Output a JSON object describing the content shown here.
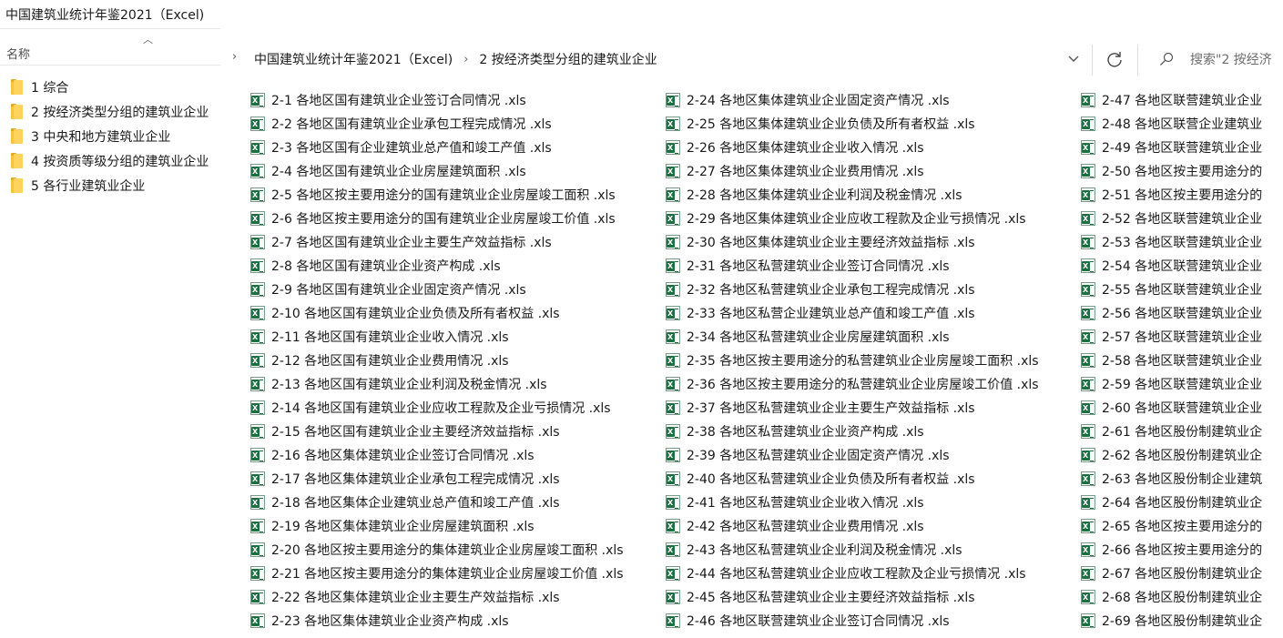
{
  "window": {
    "title": "中国建筑业统计年鉴2021（Excel)"
  },
  "left_pane": {
    "column_header": "名称",
    "folders": [
      {
        "label": "1 综合"
      },
      {
        "label": "2 按经济类型分组的建筑业企业"
      },
      {
        "label": "3 中央和地方建筑业企业"
      },
      {
        "label": "4 按资质等级分组的建筑业企业"
      },
      {
        "label": "5 各行业建筑业企业"
      }
    ]
  },
  "address_bar": {
    "crumbs": [
      "中国建筑业统计年鉴2021（Excel)",
      "2 按经济类型分组的建筑业企业"
    ],
    "search_placeholder": "搜索\"2 按经济"
  },
  "files": {
    "col1": [
      "2-1 各地区国有建筑业企业签订合同情况 .xls",
      "2-2 各地区国有建筑业企业承包工程完成情况 .xls",
      "2-3 各地区国有企业建筑业总产值和竣工产值 .xls",
      "2-4 各地区国有建筑业企业房屋建筑面积 .xls",
      "2-5 各地区按主要用途分的国有建筑业企业房屋竣工面积 .xls",
      "2-6 各地区按主要用途分的国有建筑业企业房屋竣工价值 .xls",
      "2-7 各地区国有建筑业企业主要生产效益指标 .xls",
      "2-8 各地区国有建筑业企业资产构成 .xls",
      "2-9 各地区国有建筑业企业固定资产情况 .xls",
      "2-10 各地区国有建筑业企业负债及所有者权益 .xls",
      "2-11 各地区国有建筑业企业收入情况 .xls",
      "2-12 各地区国有建筑业企业费用情况 .xls",
      "2-13 各地区国有建筑业企业利润及税金情况 .xls",
      "2-14 各地区国有建筑业企业应收工程款及企业亏损情况 .xls",
      "2-15 各地区国有建筑业企业主要经济效益指标 .xls",
      "2-16 各地区集体建筑业企业签订合同情况 .xls",
      "2-17 各地区集体建筑业企业承包工程完成情况 .xls",
      "2-18 各地区集体企业建筑业总产值和竣工产值 .xls",
      "2-19 各地区集体建筑业企业房屋建筑面积 .xls",
      "2-20 各地区按主要用途分的集体建筑业企业房屋竣工面积 .xls",
      "2-21 各地区按主要用途分的集体建筑业企业房屋竣工价值 .xls",
      "2-22 各地区集体建筑业企业主要生产效益指标 .xls",
      "2-23 各地区集体建筑业企业资产构成 .xls"
    ],
    "col2": [
      "2-24 各地区集体建筑业企业固定资产情况 .xls",
      "2-25 各地区集体建筑业企业负债及所有者权益 .xls",
      "2-26 各地区集体建筑业企业收入情况 .xls",
      "2-27 各地区集体建筑业企业费用情况 .xls",
      "2-28 各地区集体建筑业企业利润及税金情况 .xls",
      "2-29 各地区集体建筑业企业应收工程款及企业亏损情况 .xls",
      "2-30 各地区集体建筑业企业主要经济效益指标 .xls",
      "2-31 各地区私营建筑业企业签订合同情况 .xls",
      "2-32 各地区私营建筑业企业承包工程完成情况 .xls",
      "2-33 各地区私营企业建筑业总产值和竣工产值 .xls",
      "2-34 各地区私营建筑业企业房屋建筑面积 .xls",
      "2-35 各地区按主要用途分的私营建筑业企业房屋竣工面积 .xls",
      "2-36 各地区按主要用途分的私营建筑业企业房屋竣工价值 .xls",
      "2-37 各地区私营建筑业企业主要生产效益指标 .xls",
      "2-38 各地区私营建筑业企业资产构成 .xls",
      "2-39 各地区私营建筑业企业固定资产情况 .xls",
      "2-40 各地区私营建筑业企业负债及所有者权益 .xls",
      "2-41 各地区私营建筑业企业收入情况 .xls",
      "2-42 各地区私营建筑业企业费用情况 .xls",
      "2-43 各地区私营建筑业企业利润及税金情况 .xls",
      "2-44 各地区私营建筑业企业应收工程款及企业亏损情况 .xls",
      "2-45 各地区私营建筑业企业主要经济效益指标 .xls",
      "2-46 各地区联营建筑业企业签订合同情况 .xls"
    ],
    "col3": [
      "2-47 各地区联营建筑业企业",
      "2-48 各地区联营企业建筑业",
      "2-49 各地区联营建筑业企业",
      "2-50 各地区按主要用途分的",
      "2-51 各地区按主要用途分的",
      "2-52 各地区联营建筑业企业",
      "2-53 各地区联营建筑业企业",
      "2-54 各地区联营建筑业企业",
      "2-55 各地区联营建筑业企业",
      "2-56 各地区联营建筑业企业",
      "2-57 各地区联营建筑业企业",
      "2-58 各地区联营建筑业企业",
      "2-59 各地区联营建筑业企业",
      "2-60 各地区联营建筑业企业",
      "2-61 各地区股份制建筑业企",
      "2-62 各地区股份制建筑业企",
      "2-63 各地区股份制企业建筑",
      "2-64 各地区股份制建筑业企",
      "2-65 各地区按主要用途分的",
      "2-66 各地区按主要用途分的",
      "2-67 各地区股份制建筑业企",
      "2-68 各地区股份制建筑业企",
      "2-69 各地区股份制建筑业企"
    ]
  },
  "colors": {
    "excel_green": "#1d6f42",
    "folder_yellow": "#f5c542",
    "hover_blue": "#e5f3ff"
  }
}
